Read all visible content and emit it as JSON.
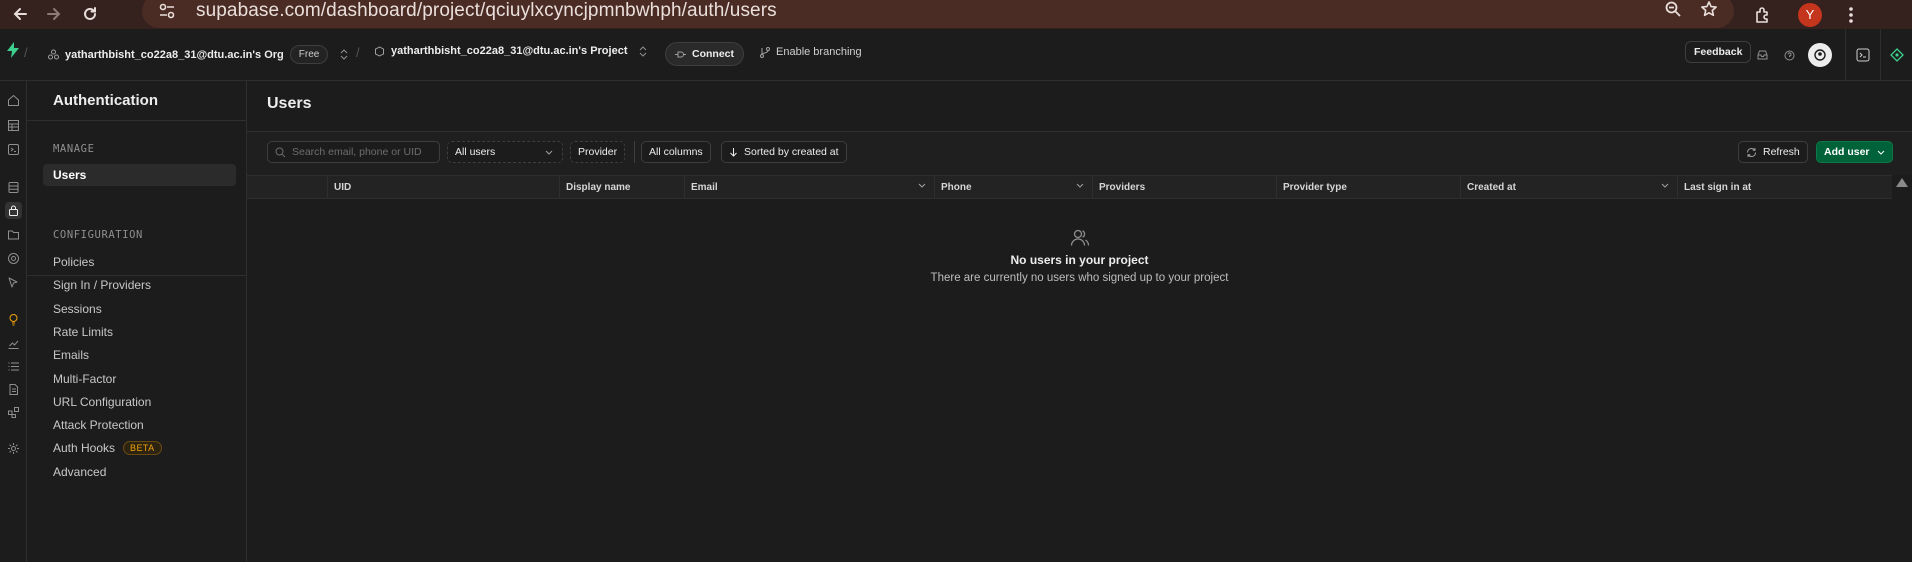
{
  "browser": {
    "url": "supabase.com/dashboard/project/qciuylxcyncjpmnbwhph/auth/users",
    "profile_initial": "Y"
  },
  "topbar": {
    "org_name": "yatharthbisht_co22a8_31@dtu.ac.in's Org",
    "plan_badge": "Free",
    "project_name": "yatharthbisht_co22a8_31@dtu.ac.in's Project",
    "connect_label": "Connect",
    "branching_label": "Enable branching",
    "feedback_label": "Feedback"
  },
  "sidebar": {
    "title": "Authentication",
    "manage_label": "MANAGE",
    "manage_items": [
      {
        "label": "Users"
      }
    ],
    "config_label": "CONFIGURATION",
    "config_items": [
      {
        "label": "Policies"
      },
      {
        "label": "Sign In / Providers"
      },
      {
        "label": "Sessions"
      },
      {
        "label": "Rate Limits"
      },
      {
        "label": "Emails"
      },
      {
        "label": "Multi-Factor"
      },
      {
        "label": "URL Configuration"
      },
      {
        "label": "Attack Protection"
      },
      {
        "label": "Auth Hooks",
        "badge": "BETA"
      },
      {
        "label": "Advanced"
      }
    ]
  },
  "main": {
    "title": "Users",
    "search_placeholder": "Search email, phone or UID",
    "filter_users": "All users",
    "provider_label": "Provider",
    "columns_label": "All columns",
    "sort_label": "Sorted by created at",
    "refresh_label": "Refresh",
    "add_user_label": "Add user",
    "columns": [
      "UID",
      "Display name",
      "Email",
      "Phone",
      "Providers",
      "Provider type",
      "Created at",
      "Last sign in at"
    ],
    "empty_title": "No users in your project",
    "empty_subtitle": "There are currently no users who signed up to your project"
  },
  "colors": {
    "accent_green": "#3ecf8e",
    "add_button": "#006239",
    "browser_bar": "#35211d"
  }
}
